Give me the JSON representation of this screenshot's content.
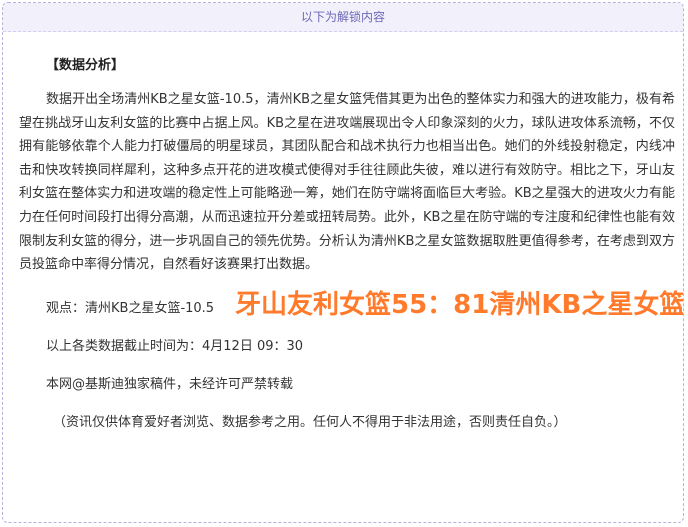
{
  "banner": "以下为解锁内容",
  "heading": "【数据分析】",
  "paragraph": "数据开出全场清州KB之星女篮-10.5，清州KB之星女篮凭借其更为出色的整体实力和强大的进攻能力，极有希望在挑战牙山友利女篮的比赛中占据上风。KB之星在进攻端展现出令人印象深刻的火力，球队进攻体系流畅，不仅拥有能够依靠个人能力打破僵局的明星球员，其团队配合和战术执行力也相当出色。她们的外线投射稳定，内线冲击和快攻转换同样犀利，这种多点开花的进攻模式使得对手往往顾此失彼，难以进行有效防守。相比之下，牙山友利女篮在整体实力和进攻端的稳定性上可能略逊一筹，她们在防守端将面临巨大考验。KB之星强大的进攻火力有能力在任何时间段打出得分高潮，从而迅速拉开分差或扭转局势。此外，KB之星在防守端的专注度和纪律性也能有效限制友利女篮的得分，进一步巩固自己的领先优势。分析认为清州KB之星女篮数据取胜更值得参考，在考虑到双方员投篮命中率得分情况，自然看好该赛果打出数据。",
  "viewpoint": "观点：清州KB之星女篮-10.5",
  "cutoff": "以上各类数据截止时间为：4月12日 09：30",
  "copyright": "本网@基斯迪独家稿件，未经许可严禁转载",
  "disclaimer": "（资讯仅供体育爱好者浏览、数据参考之用。任何人不得用于非法用途，否则责任自负。）",
  "score_overlay": "牙山友利女篮55：81清州KB之星女篮",
  "colors": {
    "banner_bg": "#f1f0fb",
    "banner_text": "#6e69b5",
    "border": "#b6b0dd",
    "score": "#ff7a2b"
  }
}
